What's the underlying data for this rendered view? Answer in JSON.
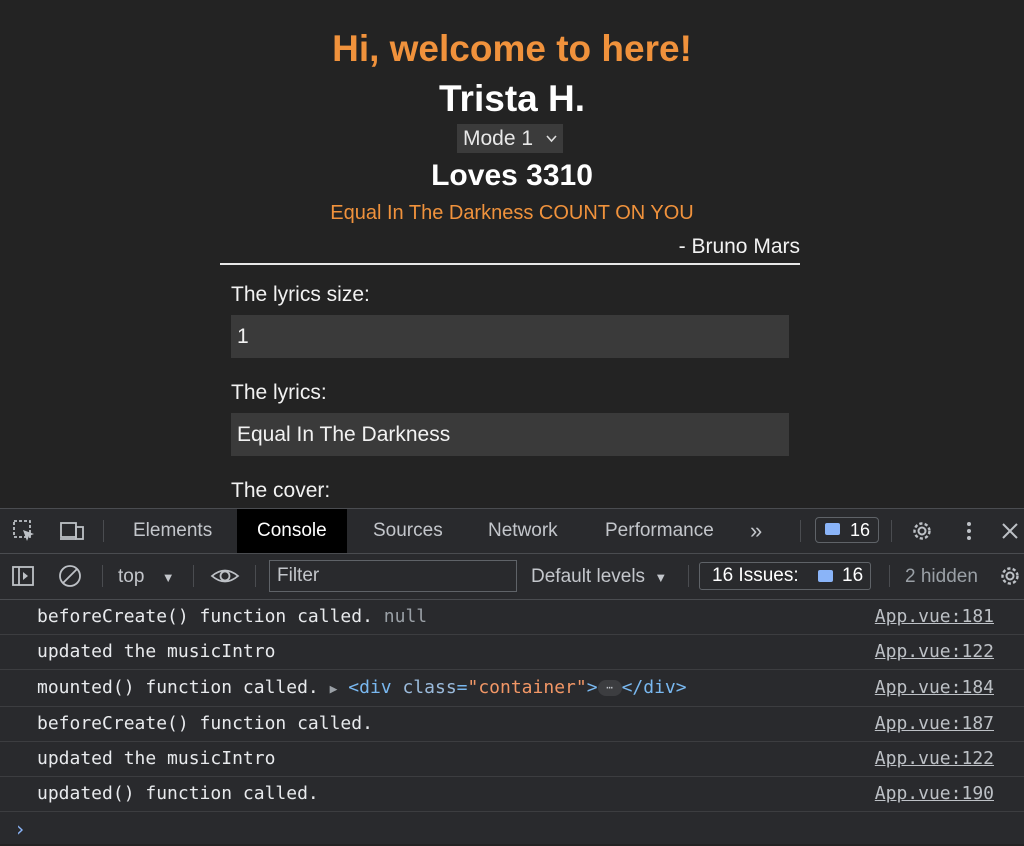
{
  "page": {
    "greeting": "Hi, welcome to here!",
    "name": "Trista H.",
    "mode": "Mode 1",
    "loves": "Loves 3310",
    "lyric_line": "Equal In The Darkness COUNT ON YOU",
    "artist": "- Bruno Mars",
    "fields": [
      {
        "label": "The lyrics size:",
        "value": "1"
      },
      {
        "label": "The lyrics:",
        "value": "Equal In The Darkness"
      },
      {
        "label": "The cover:"
      }
    ]
  },
  "devtools": {
    "tabs": [
      "Elements",
      "Console",
      "Sources",
      "Network",
      "Performance"
    ],
    "more": "»",
    "issues_badge": "16",
    "context": "top",
    "filter_placeholder": "Filter",
    "levels": "Default levels",
    "issues_label": "16 Issues:",
    "issues_count": "16",
    "hidden": "2 hidden"
  },
  "console": {
    "rows": [
      {
        "text": "beforeCreate() function called. ",
        "extra": "null",
        "source": "App.vue:181"
      },
      {
        "text": "updated the musicIntro",
        "source": "App.vue:122"
      },
      {
        "text": "mounted() function called. ",
        "source": "App.vue:184"
      },
      {
        "text": "beforeCreate() function called.",
        "source": "App.vue:187"
      },
      {
        "text": "updated the musicIntro",
        "source": "App.vue:122"
      },
      {
        "text": "updated() function called.",
        "source": "App.vue:190"
      }
    ],
    "element": {
      "open": "<div ",
      "attr": "class",
      "eq": "=",
      "value": "\"container\"",
      "close_open": ">",
      "ellipsis": "⋯",
      "close": "</div>"
    },
    "prompt": "›"
  },
  "colors": {
    "accent": "#f0923c",
    "devtools_bg": "#292a2d",
    "link_blue": "#8ab4f8"
  }
}
